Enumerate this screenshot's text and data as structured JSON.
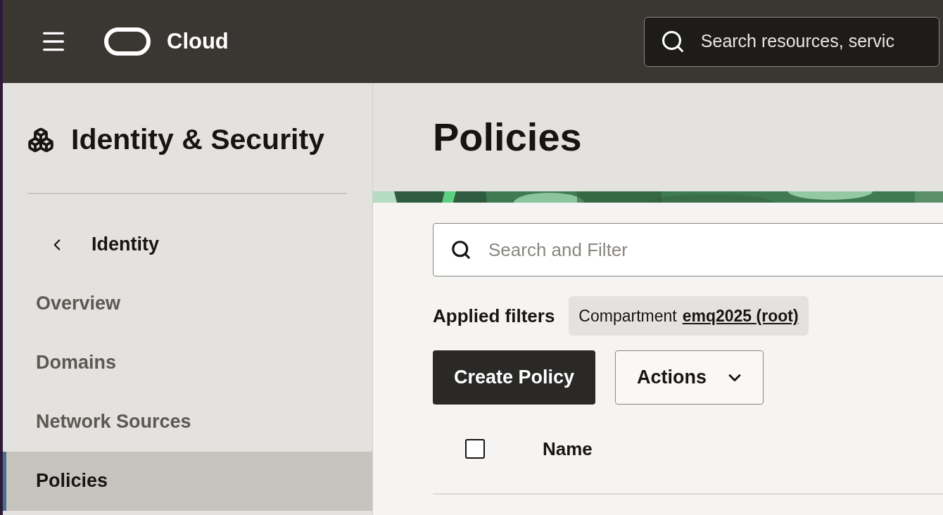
{
  "header": {
    "brand": "Cloud",
    "search": {
      "placeholder": "Search resources, servic"
    }
  },
  "sidebar": {
    "title": "Identity & Security",
    "back": "Identity",
    "items": [
      {
        "label": "Overview",
        "selected": false
      },
      {
        "label": "Domains",
        "selected": false
      },
      {
        "label": "Network Sources",
        "selected": false
      },
      {
        "label": "Policies",
        "selected": true
      }
    ]
  },
  "page": {
    "title": "Policies",
    "search": {
      "placeholder": "Search and Filter"
    },
    "applied_filters": {
      "label": "Applied filters",
      "chips": [
        {
          "name": "Compartment",
          "value": "emq2025 (root)"
        }
      ]
    },
    "buttons": [
      {
        "label": "Create Policy",
        "kind": "primary"
      },
      {
        "label": "Actions",
        "kind": "menu"
      }
    ],
    "table": {
      "select_all": {
        "checked": false
      },
      "columns": [
        "Name"
      ]
    }
  }
}
